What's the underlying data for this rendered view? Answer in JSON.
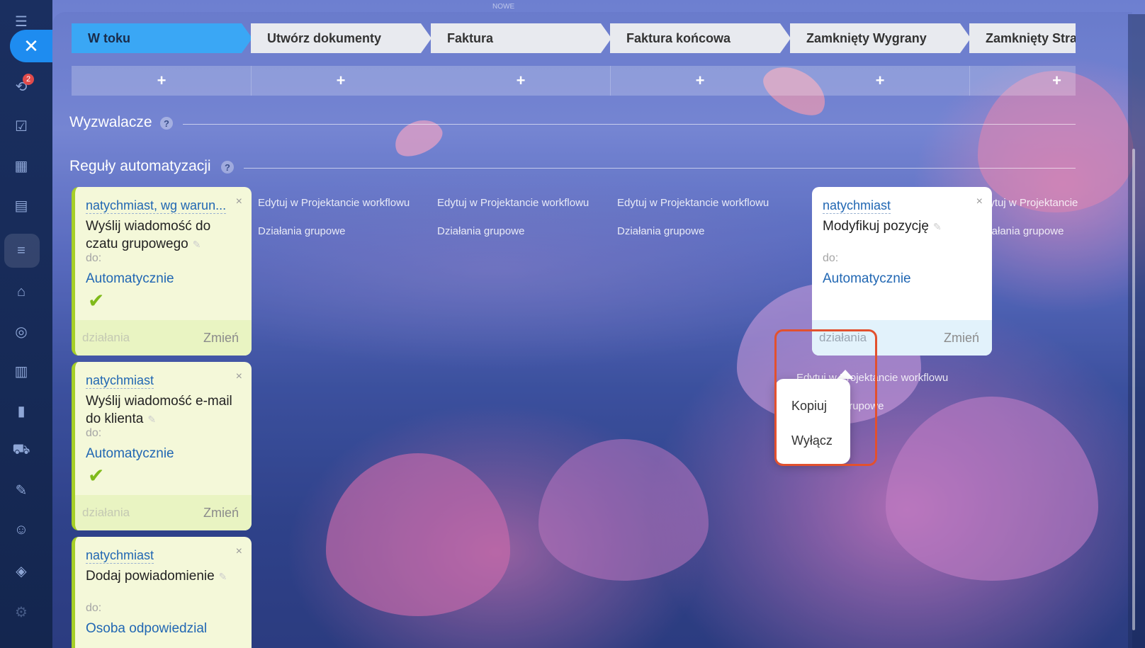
{
  "top_label": "NOWE",
  "rail": {
    "badge_count": "2",
    "icons": [
      "menu-icon",
      "close-icon",
      "workflow-icon",
      "tasks-icon",
      "calendar-icon",
      "contact-card-icon",
      "filter-icon",
      "store-icon",
      "target-icon",
      "schedule-icon",
      "chart-icon",
      "cart-icon",
      "edit-icon",
      "robot-icon",
      "package-icon",
      "settings-icon"
    ]
  },
  "stages": [
    {
      "label": "W toku",
      "active": true
    },
    {
      "label": "Utwórz dokumenty",
      "active": false
    },
    {
      "label": "Faktura",
      "active": false
    },
    {
      "label": "Faktura końcowa",
      "active": false
    },
    {
      "label": "Zamknięty Wygrany",
      "active": false
    },
    {
      "label": "Zamknięty Strac",
      "active": false
    }
  ],
  "add_label": "+",
  "sections": {
    "triggers": "Wyzwalacze",
    "rules": "Reguły automatyzacji",
    "help": "?"
  },
  "cards": [
    {
      "when": "natychmiast, wg warun...",
      "name": "Wyślij wiadomość do czatu grupowego",
      "to": "do:",
      "who": "Automatycznie",
      "actions": "działania",
      "change": "Zmień",
      "close": "×"
    },
    {
      "when": "natychmiast",
      "name": "Wyślij wiadomość e-mail do klienta",
      "to": "do:",
      "who": "Automatycznie",
      "actions": "działania",
      "change": "Zmień",
      "close": "×"
    },
    {
      "when": "natychmiast",
      "name": "Dodaj powiadomienie",
      "to": "do:",
      "who": "Osoba odpowiedzial",
      "close": "×"
    },
    {
      "when": "natychmiast",
      "name": "Modyfikuj pozycję",
      "to": "do:",
      "who": "Automatycznie",
      "actions": "działania",
      "change": "Zmień",
      "close": "×"
    }
  ],
  "column_links": {
    "edit": "Edytuj w Projektancie workflowu",
    "edit_cut": "Edytuj w Projektancie",
    "group": "Działania grupowe"
  },
  "popup": {
    "items": [
      "Kopiuj",
      "Wyłącz"
    ]
  },
  "colors": {
    "accent": "#3aa7f5",
    "highlight": "#e2512e",
    "card_green": "#f4f8d9",
    "link": "#2167b3"
  }
}
